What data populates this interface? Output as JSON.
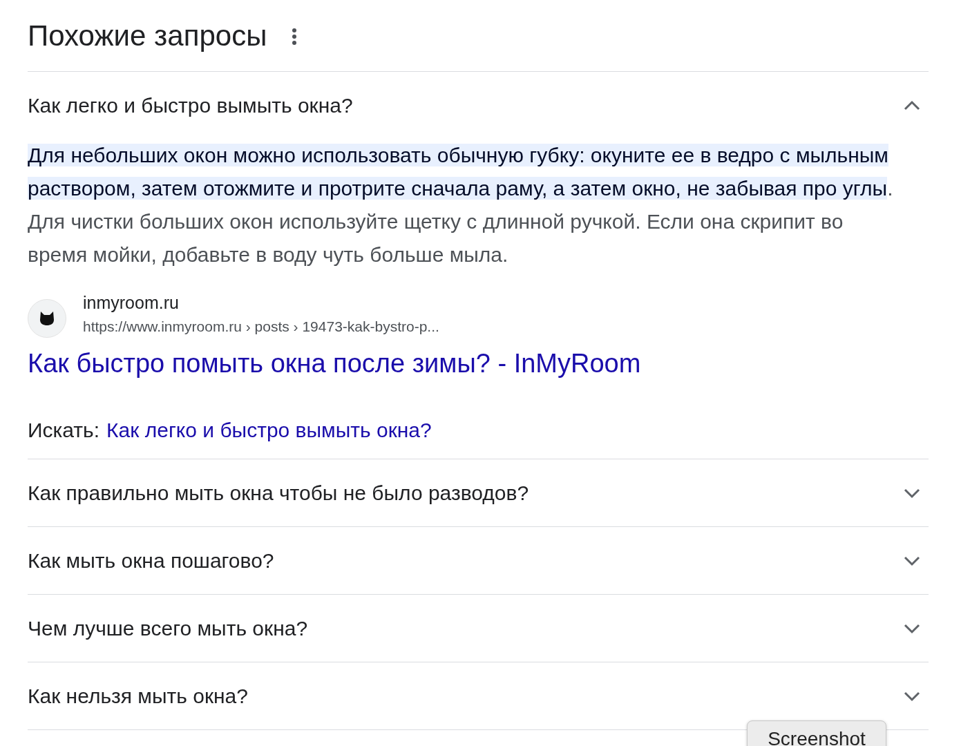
{
  "title": "Похожие запросы",
  "questions": [
    {
      "text": "Как легко и быстро вымыть окна?",
      "expanded": true,
      "answer": {
        "highlighted": "Для небольших окон можно использовать обычную губку: окуните ее в ведро с мыльным раствором, затем отожмите и протрите сначала раму, а затем окно, не забывая про углы",
        "text": ". Для чистки больших окон используйте щетку с длинной ручкой. Если она скрипит во время мойки, добавьте в воду чуть больше мыла."
      },
      "source": {
        "site": "inmyroom.ru",
        "url": "https://www.inmyroom.ru › posts › 19473-kak-bystro-p...",
        "link": "Как быстро помыть окна после зимы? - InMyRoom"
      },
      "search": {
        "label": "Искать:",
        "query": "Как легко и быстро вымыть окна?"
      }
    },
    {
      "text": "Как правильно мыть окна чтобы не было разводов?",
      "expanded": false
    },
    {
      "text": "Как мыть окна пошагово?",
      "expanded": false
    },
    {
      "text": "Чем лучше всего мыть окна?",
      "expanded": false
    },
    {
      "text": "Как нельзя мыть окна?",
      "expanded": false
    }
  ],
  "overlay_tab": "Screenshot"
}
